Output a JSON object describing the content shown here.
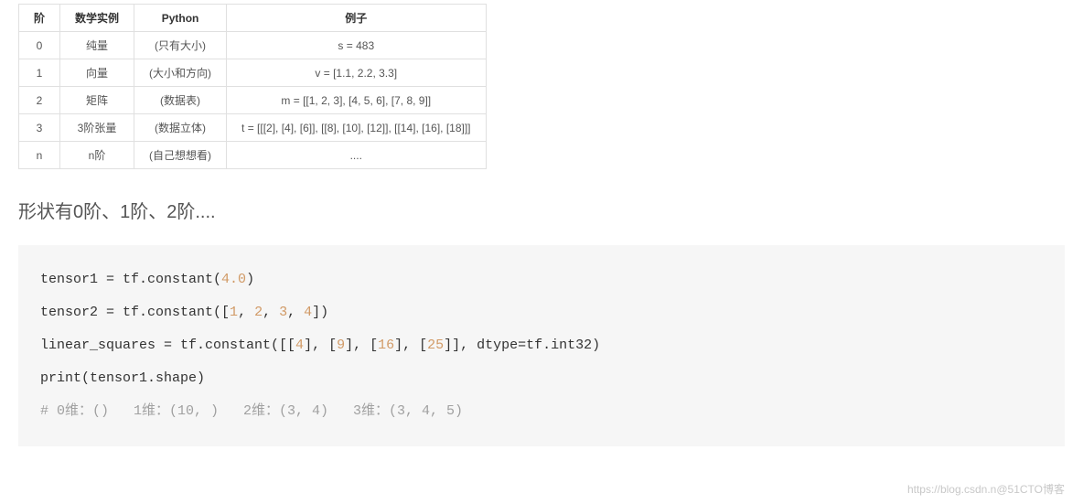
{
  "table": {
    "headers": [
      "阶",
      "数学实例",
      "Python",
      "例子"
    ],
    "rows": [
      {
        "c0": "0",
        "c1": "纯量",
        "c2": "(只有大小)",
        "c3": "s = 483"
      },
      {
        "c0": "1",
        "c1": "向量",
        "c2": "(大小和方向)",
        "c3": "v = [1.1, 2.2, 3.3]"
      },
      {
        "c0": "2",
        "c1": "矩阵",
        "c2": "(数据表)",
        "c3": "m = [[1, 2, 3], [4, 5, 6], [7, 8, 9]]"
      },
      {
        "c0": "3",
        "c1": "3阶张量",
        "c2": "(数据立体)",
        "c3": "t = [[[2], [4], [6]], [[8], [10], [12]], [[14], [16], [18]]]"
      },
      {
        "c0": "n",
        "c1": "n阶",
        "c2": "(自己想想看)",
        "c3": "...."
      }
    ]
  },
  "heading": "形状有0阶、1阶、2阶....",
  "code": {
    "l1a": "tensor1 = tf.constant(",
    "l1n": "4.0",
    "l1b": ")",
    "l2a": "tensor2 = tf.constant([",
    "l2n1": "1",
    "l2s": ", ",
    "l2n2": "2",
    "l2n3": "3",
    "l2n4": "4",
    "l2b": "])",
    "l3a": "linear_squares = tf.constant([[",
    "l3n1": "4",
    "l3m": "], [",
    "l3n2": "9",
    "l3n3": "16",
    "l3n4": "25",
    "l3b": "]], dtype=tf.int32)",
    "l4": "print(tensor1.shape)",
    "l5": "# 0维：()   1维：(10, )   2维：(3, 4)   3维：(3, 4, 5)"
  },
  "watermark": "https://blog.csdn.n@51CTO博客"
}
